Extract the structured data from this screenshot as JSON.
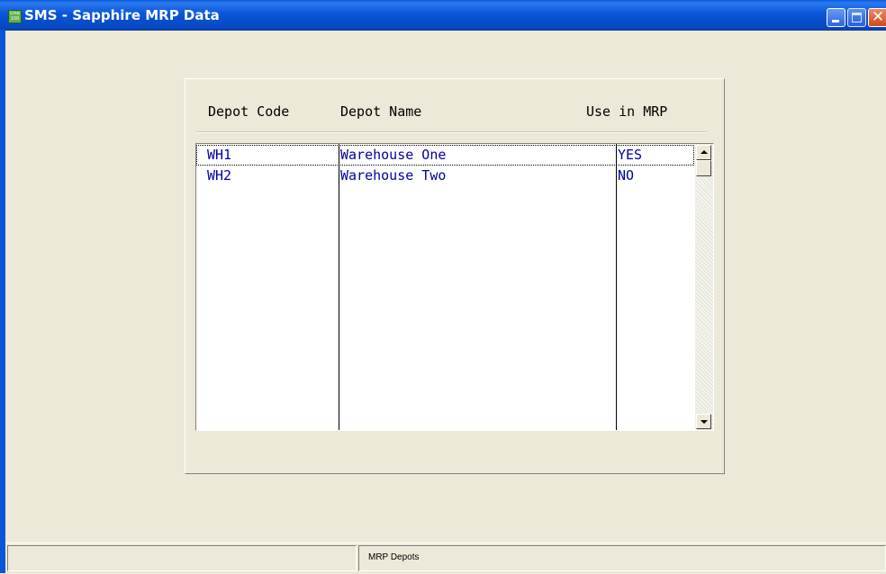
{
  "window": {
    "title": "SMS - Sapphire MRP Data",
    "icon_name": "line-100-app-icon",
    "icon_text_top": "Line",
    "icon_text_bottom": "100"
  },
  "panel": {
    "headers": {
      "depot_code": "Depot Code",
      "depot_name": "Depot Name",
      "use_in_mrp": "Use in MRP"
    },
    "rows": [
      {
        "code": "WH1",
        "name": "Warehouse One",
        "use_in_mrp": "YES",
        "selected": true
      },
      {
        "code": "WH2",
        "name": "Warehouse Two",
        "use_in_mrp": "NO",
        "selected": false
      }
    ]
  },
  "statusbar": {
    "pane1": "",
    "pane2": "MRP Depots"
  },
  "colors": {
    "titlebar": "#0a56d6",
    "cell_text": "#0000a0",
    "background": "#ece9d8"
  }
}
